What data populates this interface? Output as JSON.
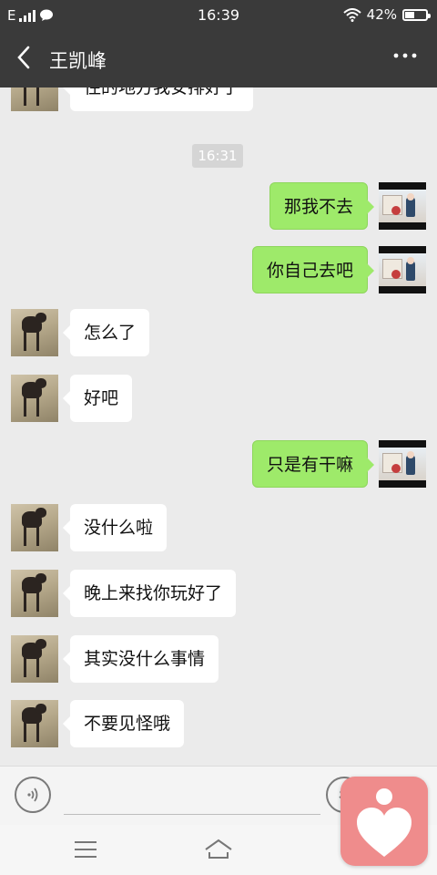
{
  "status_bar": {
    "network": "E",
    "time": "16:39",
    "battery": "42%",
    "battery_level": 0.42
  },
  "nav": {
    "title": "王凯峰",
    "back_icon": "chevron-left-icon",
    "more_icon": "more-icon"
  },
  "messages": [
    {
      "side": "in",
      "text": "住的地方我安排好了"
    },
    {
      "type": "timestamp",
      "text": "16:31"
    },
    {
      "side": "out",
      "text": "那我不去"
    },
    {
      "side": "out",
      "text": "你自己去吧"
    },
    {
      "side": "in",
      "text": "怎么了"
    },
    {
      "side": "in",
      "text": "好吧"
    },
    {
      "side": "out",
      "text": "只是有干嘛"
    },
    {
      "side": "in",
      "text": "没什么啦"
    },
    {
      "side": "in",
      "text": "晚上来找你玩好了"
    },
    {
      "side": "in",
      "text": "其实没什么事情"
    },
    {
      "side": "in",
      "text": "不要见怪哦"
    }
  ],
  "input_bar": {
    "voice_icon": "voice-icon",
    "emoji_icon": "emoji-icon",
    "plus_icon": "plus-icon",
    "input_value": ""
  },
  "colors": {
    "header_bg": "#3a3a3a",
    "chat_bg": "#ebebeb",
    "outgoing_bubble": "#9eea6a",
    "incoming_bubble": "#ffffff",
    "heart_app": "#ef8c8c"
  }
}
